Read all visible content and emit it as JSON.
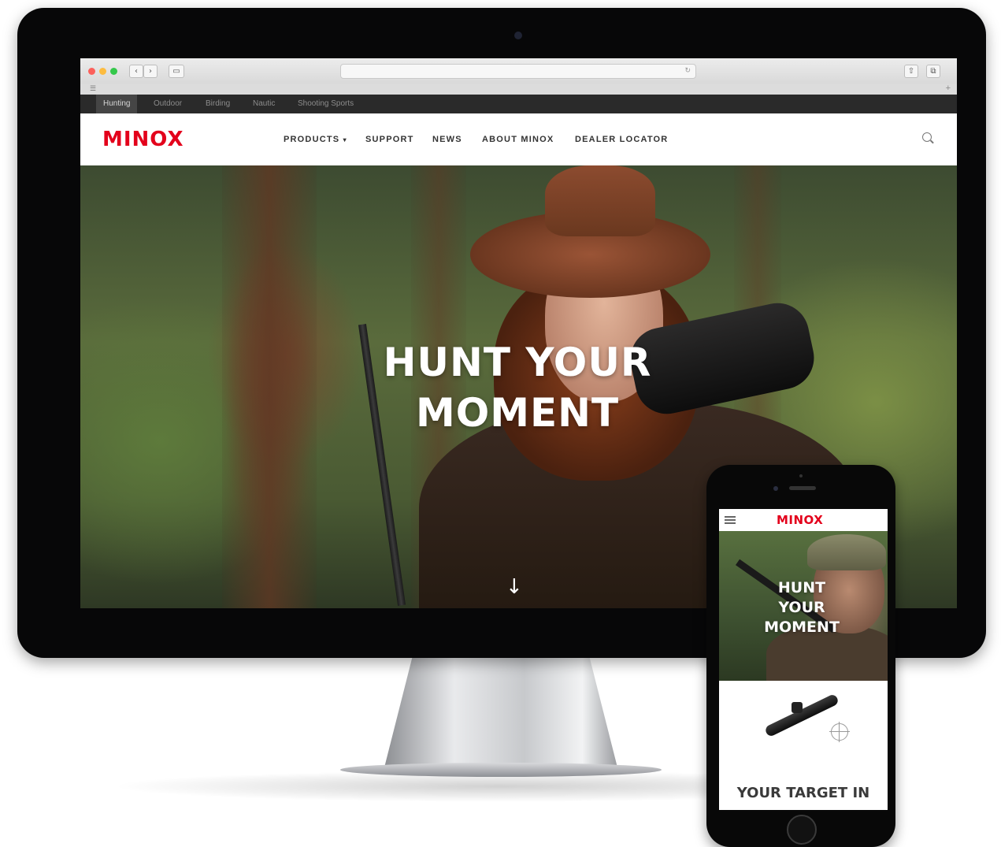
{
  "browser": {
    "nav_back": "‹",
    "nav_forward": "›",
    "category_tabs": [
      "Hunting",
      "Outdoor",
      "Birding",
      "Nautic",
      "Shooting Sports"
    ],
    "active_tab": "Hunting"
  },
  "site": {
    "logo": "MINOX",
    "nav": [
      "PRODUCTS",
      "SUPPORT",
      "NEWS",
      "ABOUT MINOX",
      "DEALER LOCATOR"
    ],
    "products_caret": "▾"
  },
  "hero": {
    "headline_line1": "HUNT YOUR",
    "headline_line2": "MOMENT",
    "scroll_arrow": "↓"
  },
  "mobile": {
    "logo": "MINOX",
    "headline_line1": "HUNT",
    "headline_line2": "YOUR",
    "headline_line3": "MOMENT",
    "teaser": "YOUR TARGET IN"
  },
  "colors": {
    "brand_red": "#e3001b"
  },
  "icons": [
    "search-icon",
    "hamburger-menu-icon",
    "arrow-down-icon",
    "crosshair-icon"
  ]
}
